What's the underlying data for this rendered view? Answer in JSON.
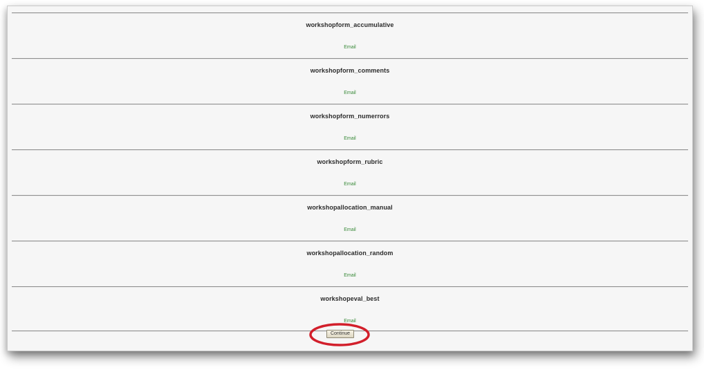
{
  "plugins": [
    {
      "name": "workshopform_accumulative",
      "action": "Email"
    },
    {
      "name": "workshopform_comments",
      "action": "Email"
    },
    {
      "name": "workshopform_numerrors",
      "action": "Email"
    },
    {
      "name": "workshopform_rubric",
      "action": "Email"
    },
    {
      "name": "workshopallocation_manual",
      "action": "Email"
    },
    {
      "name": "workshopallocation_random",
      "action": "Email"
    },
    {
      "name": "workshopeval_best",
      "action": "Email"
    }
  ],
  "continue_label": "Continue",
  "highlight_color": "#d21f2b"
}
